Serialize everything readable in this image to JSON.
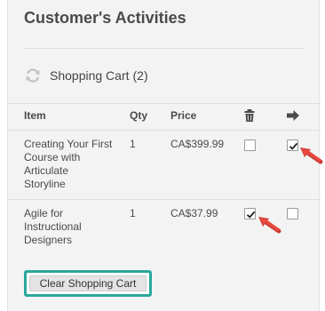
{
  "panel": {
    "title": "Customer's Activities"
  },
  "cart": {
    "icon": "refresh-icon",
    "label": "Shopping Cart",
    "count": "(2)"
  },
  "table": {
    "headers": {
      "item": "Item",
      "qty": "Qty",
      "price": "Price",
      "remove_icon": "trash-icon",
      "move_icon": "arrow-right-icon"
    },
    "rows": [
      {
        "name": "Creating Your First Course with Articulate Storyline",
        "qty": "1",
        "price": "CA$399.99",
        "remove_checked": false,
        "move_checked": true
      },
      {
        "name": "Agile for Instructional Designers",
        "qty": "1",
        "price": "CA$37.99",
        "remove_checked": true,
        "move_checked": false
      }
    ]
  },
  "actions": {
    "clear_label": "Clear Shopping Cart"
  },
  "colors": {
    "highlight": "#2aa89a",
    "annotation_arrow": "#e8483f",
    "panel_bg": "#f3f3f3"
  }
}
